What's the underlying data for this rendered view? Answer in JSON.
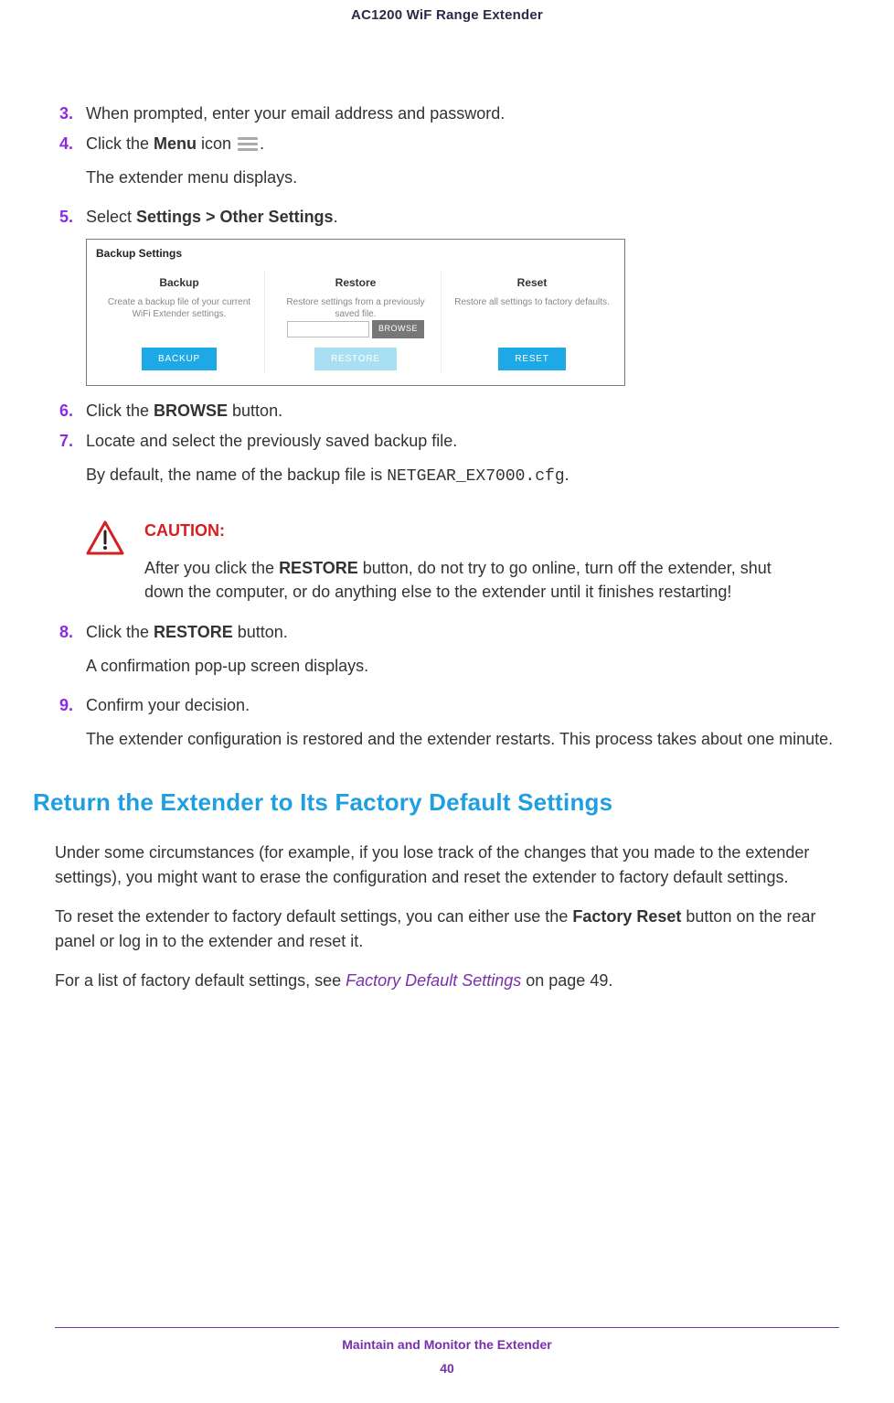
{
  "header": {
    "title": "AC1200 WiF Range Extender"
  },
  "steps": {
    "s3": {
      "num": "3.",
      "text": "When prompted, enter your email address and password."
    },
    "s4": {
      "num": "4.",
      "text_pre": "Click the ",
      "bold": "Menu",
      "text_mid": " icon ",
      "text_post": ".",
      "follow": "The extender menu displays."
    },
    "s5": {
      "num": "5.",
      "text_pre": "Select ",
      "bold": "Settings > Other Settings",
      "text_post": "."
    },
    "s6": {
      "num": "6.",
      "text_pre": "Click the ",
      "bold": "BROWSE",
      "text_post": " button."
    },
    "s7": {
      "num": "7.",
      "text": "Locate and select the previously saved backup file.",
      "follow_pre": "By default, the name of the backup file is ",
      "follow_code": "NETGEAR_EX7000.cfg",
      "follow_post": "."
    },
    "s8": {
      "num": "8.",
      "text_pre": "Click the ",
      "bold": "RESTORE",
      "text_post": " button.",
      "follow": "A confirmation pop-up screen displays."
    },
    "s9": {
      "num": "9.",
      "text": "Confirm your decision.",
      "follow": "The extender configuration is restored and the extender restarts. This process takes about one minute."
    }
  },
  "screenshot": {
    "title": "Backup Settings",
    "backup": {
      "head": "Backup",
      "desc": "Create a backup file of your current WiFi Extender settings.",
      "btn": "BACKUP"
    },
    "restore": {
      "head": "Restore",
      "desc": "Restore settings from a previously saved file.",
      "browse": "BROWSE",
      "btn": "RESTORE"
    },
    "reset": {
      "head": "Reset",
      "desc": "Restore all settings to factory defaults.",
      "btn": "RESET"
    }
  },
  "caution": {
    "label": "CAUTION:",
    "text_pre": "After you click the ",
    "bold": "RESTORE",
    "text_post": " button, do not try to go online, turn off the extender, shut down the computer, or do anything else to the extender until it finishes restarting!"
  },
  "section": {
    "heading": "Return the Extender to Its Factory Default Settings",
    "p1": "Under some circumstances (for example, if you lose track of the changes that you made to the extender settings), you might want to erase the configuration and reset the extender to factory default settings.",
    "p2_pre": "To reset the extender to factory default settings, you can either use the ",
    "p2_bold": "Factory Reset",
    "p2_post": " button on the rear panel or log in to the extender and reset it.",
    "p3_pre": "For a list of factory default settings, see ",
    "p3_link": "Factory Default Settings",
    "p3_post": " on page 49."
  },
  "footer": {
    "title": "Maintain and Monitor the Extender",
    "page": "40"
  }
}
